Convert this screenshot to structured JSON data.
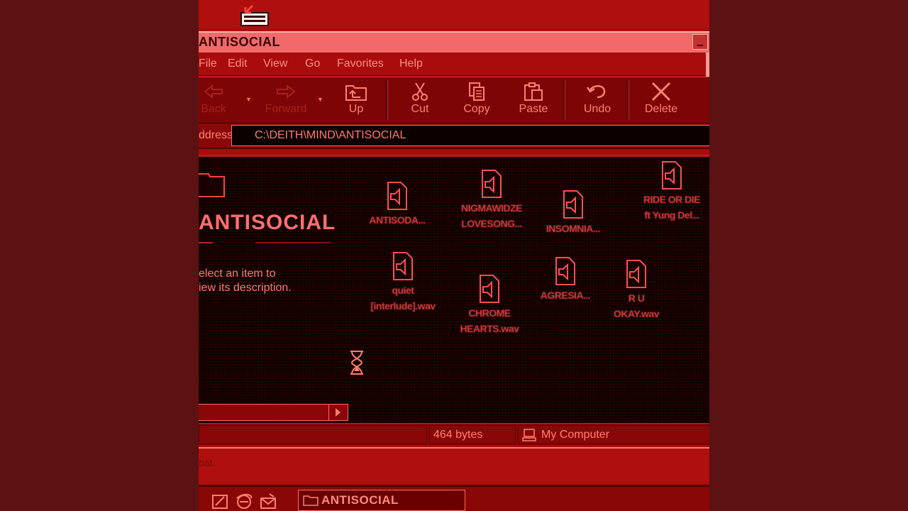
{
  "window": {
    "title": "ANTISOCIAL"
  },
  "menu": {
    "items": [
      "File",
      "Edit",
      "View",
      "Go",
      "Favorites",
      "Help"
    ]
  },
  "toolbar": {
    "back": "Back",
    "forward": "Forward",
    "up": "Up",
    "cut": "Cut",
    "copy": "Copy",
    "paste": "Paste",
    "undo": "Undo",
    "delete": "Delete"
  },
  "address": {
    "label": "ddress",
    "value": "C:\\DEITH\\MIND\\ANTISOCIAL"
  },
  "folder_panel": {
    "title": "ANTISOCIAL",
    "description": "elect an item to\niew its description."
  },
  "files": [
    {
      "label_1": "ANTISODA...",
      "label_2": ""
    },
    {
      "label_1": "NIGMAWIDZE",
      "label_2": "LOVESONG..."
    },
    {
      "label_1": "INSOMNIA...",
      "label_2": ""
    },
    {
      "label_1": "RIDE OR DIE",
      "label_2": "ft Yung Del..."
    },
    {
      "label_1": "quiet",
      "label_2": "[interlude].wav"
    },
    {
      "label_1": "CHROME",
      "label_2": "HEARTS.wav"
    },
    {
      "label_1": "AGRESIA...",
      "label_2": ""
    },
    {
      "label_1": "R U",
      "label_2": "OKAY.wav"
    }
  ],
  "status": {
    "size": "464 bytes",
    "location": "My Computer"
  },
  "desktop": {
    "caption": "bat."
  },
  "taskbar": {
    "task_label": "ANTISOCIAL"
  },
  "colors": {
    "accent": "#ff7070",
    "window_bg": "#a80c0c",
    "content_bg": "#0d0000",
    "titlebar": "#f16a6a"
  }
}
